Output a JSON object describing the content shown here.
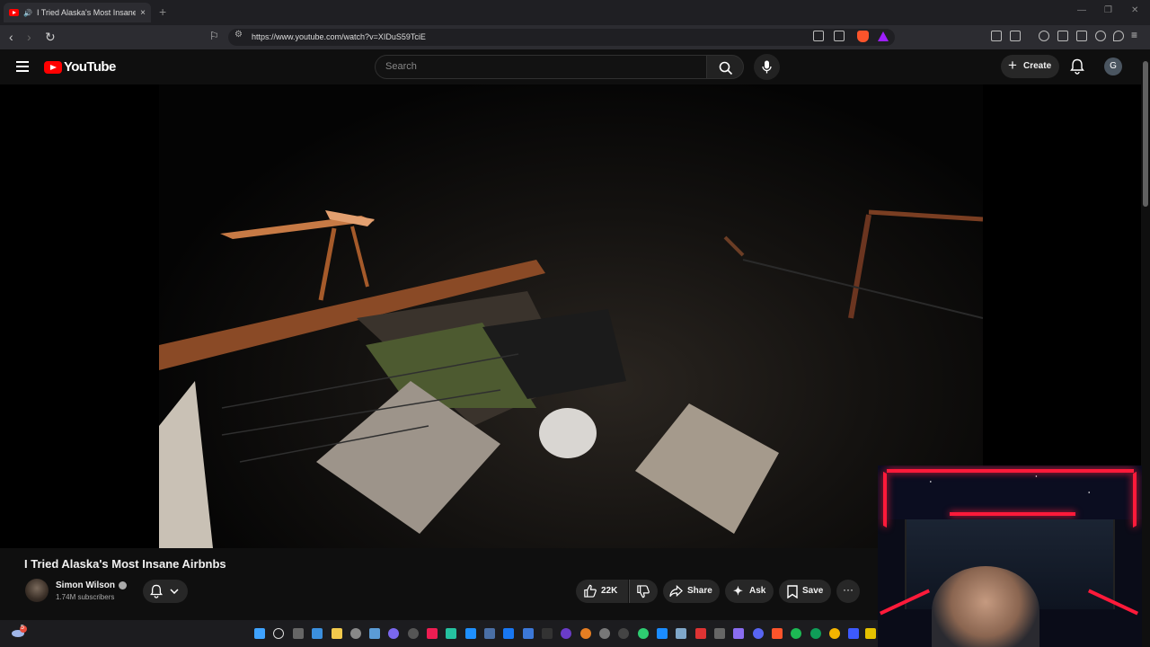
{
  "browser": {
    "tab_title": "I Tried Alaska's Most Insane A",
    "tab_close": "×",
    "new_tab": "+",
    "url": "https://www.youtube.com/watch?v=XIDuS59TciE"
  },
  "youtube": {
    "wordmark": "YouTube",
    "search_placeholder": "Search",
    "create_label": "Create",
    "account_initial": "G"
  },
  "video": {
    "title": "I Tried Alaska's Most Insane Airbnbs",
    "channel_name": "Simon Wilson",
    "subscribers": "1.74M subscribers",
    "likes": "22K",
    "share_label": "Share",
    "ask_label": "Ask",
    "save_label": "Save",
    "more_label": "···"
  },
  "taskbar": {
    "notification_count": "5"
  },
  "colors": {
    "youtube_red": "#ff0000",
    "background": "#0f0f0f",
    "pill_bg": "#272727"
  }
}
